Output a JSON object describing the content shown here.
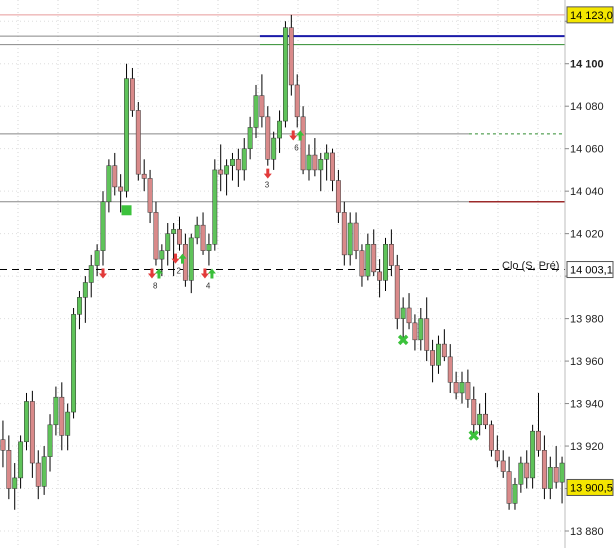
{
  "chart_data": {
    "type": "candlestick",
    "ylim": [
      13872,
      14130
    ],
    "grid": true,
    "colors": {
      "up": "#5fc35a",
      "down": "#d98a8a",
      "wick": "#000000",
      "blue_line": "#1a1aa8",
      "green_line": "#2e8b2e",
      "pink_line": "#e89a9a",
      "red_line": "#9c2a2a",
      "gray_line": "#888888",
      "label_bg": "#f4e600"
    },
    "y_ticks": [
      {
        "value": 13880,
        "label": "13 880",
        "bold": false
      },
      {
        "value": 13900,
        "label": "",
        "bold": false
      },
      {
        "value": 13920,
        "label": "13 920",
        "bold": false
      },
      {
        "value": 13940,
        "label": "13 940",
        "bold": false
      },
      {
        "value": 13960,
        "label": "13 960",
        "bold": false
      },
      {
        "value": 13980,
        "label": "13 980",
        "bold": false
      },
      {
        "value": 14000,
        "label": "",
        "bold": false
      },
      {
        "value": 14020,
        "label": "14 020",
        "bold": false
      },
      {
        "value": 14040,
        "label": "14 040",
        "bold": false
      },
      {
        "value": 14060,
        "label": "14 060",
        "bold": false
      },
      {
        "value": 14080,
        "label": "14 080",
        "bold": false
      },
      {
        "value": 14100,
        "label": "14 100",
        "bold": true
      },
      {
        "value": 14120,
        "label": "",
        "bold": false
      }
    ],
    "price_labels": [
      {
        "value": 14123.0,
        "label": "14 123,0",
        "style": "yellow"
      },
      {
        "value": 14003.1,
        "label": "14 003,1",
        "style": "outlined"
      },
      {
        "value": 13900.5,
        "label": "13 900,5",
        "style": "yellow"
      }
    ],
    "levels": [
      {
        "value": 14123,
        "x0": 0,
        "x1": 1,
        "color": "pink",
        "dash": false
      },
      {
        "value": 14113,
        "x0": 0,
        "x1": 0.46,
        "color": "gray",
        "dash": false
      },
      {
        "value": 14113,
        "x0": 0.46,
        "x1": 1,
        "color": "blue",
        "dash": false
      },
      {
        "value": 14109,
        "x0": 0,
        "x1": 0.46,
        "color": "gray",
        "dash": false
      },
      {
        "value": 14109,
        "x0": 0.46,
        "x1": 1,
        "color": "green",
        "dash": false
      },
      {
        "value": 14067,
        "x0": 0,
        "x1": 0.83,
        "color": "gray",
        "dash": false
      },
      {
        "value": 14067,
        "x0": 0.83,
        "x1": 1,
        "color": "green",
        "dash": true
      },
      {
        "value": 14035,
        "x0": 0,
        "x1": 0.83,
        "color": "gray",
        "dash": false
      },
      {
        "value": 14035,
        "x0": 0.83,
        "x1": 1,
        "color": "red",
        "dash": false
      },
      {
        "value": 14003.1,
        "x0": 0,
        "x1": 1,
        "color": "black",
        "dash": true
      }
    ],
    "annotation": {
      "text": "Clo (S, Pré)",
      "value": 14003.1
    },
    "candles": [
      [
        13923,
        13932,
        13910,
        13918
      ],
      [
        13918,
        13925,
        13895,
        13900
      ],
      [
        13900,
        13912,
        13890,
        13905
      ],
      [
        13905,
        13925,
        13900,
        13922
      ],
      [
        13922,
        13945,
        13918,
        13941
      ],
      [
        13941,
        13946,
        13905,
        13912
      ],
      [
        13912,
        13918,
        13895,
        13901
      ],
      [
        13901,
        13920,
        13897,
        13915
      ],
      [
        13915,
        13935,
        13908,
        13930
      ],
      [
        13930,
        13948,
        13925,
        13943
      ],
      [
        13943,
        13950,
        13918,
        13925
      ],
      [
        13925,
        13940,
        13918,
        13936
      ],
      [
        13936,
        13985,
        13933,
        13982
      ],
      [
        13982,
        13993,
        13975,
        13990
      ],
      [
        13990,
        14000,
        13978,
        13997
      ],
      [
        13997,
        14010,
        13990,
        14005
      ],
      [
        14005,
        14015,
        14000,
        14012
      ],
      [
        14012,
        14040,
        14005,
        14035
      ],
      [
        14035,
        14055,
        14030,
        14052
      ],
      [
        14052,
        14058,
        14038,
        14042
      ],
      [
        14042,
        14048,
        14030,
        14040
      ],
      [
        14040,
        14100,
        14037,
        14093
      ],
      [
        14093,
        14098,
        14075,
        14078
      ],
      [
        14078,
        14082,
        14045,
        14048
      ],
      [
        14048,
        14055,
        14040,
        14046
      ],
      [
        14046,
        14050,
        14025,
        14030
      ],
      [
        14030,
        14035,
        14005,
        14008
      ],
      [
        14008,
        14015,
        14000,
        14012
      ],
      [
        14012,
        14025,
        14005,
        14020
      ],
      [
        14020,
        14025,
        14000,
        14022
      ],
      [
        14022,
        14028,
        14012,
        14015
      ],
      [
        14015,
        14020,
        13995,
        13998
      ],
      [
        13998,
        14020,
        13992,
        14018
      ],
      [
        14018,
        14028,
        14015,
        14024
      ],
      [
        14024,
        14030,
        14010,
        14012
      ],
      [
        14012,
        14020,
        14005,
        14015
      ],
      [
        14015,
        14055,
        14012,
        14050
      ],
      [
        14050,
        14062,
        14040,
        14048
      ],
      [
        14048,
        14055,
        14038,
        14052
      ],
      [
        14052,
        14058,
        14045,
        14055
      ],
      [
        14055,
        14060,
        14042,
        14050
      ],
      [
        14050,
        14065,
        14045,
        14060
      ],
      [
        14060,
        14075,
        14055,
        14070
      ],
      [
        14070,
        14090,
        14065,
        14085
      ],
      [
        14085,
        14095,
        14070,
        14075
      ],
      [
        14075,
        14080,
        14052,
        14055
      ],
      [
        14055,
        14068,
        14050,
        14065
      ],
      [
        14065,
        14078,
        14058,
        14073
      ],
      [
        14073,
        14120,
        14070,
        14117
      ],
      [
        14117,
        14123,
        14085,
        14090
      ],
      [
        14090,
        14095,
        14070,
        14075
      ],
      [
        14075,
        14080,
        14048,
        14050
      ],
      [
        14050,
        14062,
        14045,
        14057
      ],
      [
        14057,
        14065,
        14047,
        14050
      ],
      [
        14050,
        14058,
        14040,
        14055
      ],
      [
        14055,
        14062,
        14045,
        14058
      ],
      [
        14058,
        14060,
        14040,
        14045
      ],
      [
        14045,
        14050,
        14025,
        14030
      ],
      [
        14030,
        14035,
        14005,
        14010
      ],
      [
        14010,
        14030,
        14005,
        14025
      ],
      [
        14025,
        14030,
        14008,
        14012
      ],
      [
        14012,
        14015,
        13995,
        14000
      ],
      [
        14000,
        14020,
        13998,
        14015
      ],
      [
        14015,
        14022,
        14000,
        14002
      ],
      [
        14002,
        14008,
        13990,
        13998
      ],
      [
        13998,
        14018,
        13993,
        14015
      ],
      [
        14015,
        14022,
        14000,
        14005
      ],
      [
        14005,
        14010,
        13975,
        13980
      ],
      [
        13980,
        13990,
        13970,
        13985
      ],
      [
        13985,
        13992,
        13975,
        13978
      ],
      [
        13978,
        13982,
        13965,
        13970
      ],
      [
        13970,
        13985,
        13965,
        13980
      ],
      [
        13980,
        13990,
        13960,
        13965
      ],
      [
        13965,
        13970,
        13950,
        13958
      ],
      [
        13958,
        13972,
        13954,
        13968
      ],
      [
        13968,
        13975,
        13960,
        13962
      ],
      [
        13962,
        13968,
        13945,
        13950
      ],
      [
        13950,
        13955,
        13942,
        13945
      ],
      [
        13945,
        13955,
        13940,
        13950
      ],
      [
        13950,
        13956,
        13938,
        13942
      ],
      [
        13942,
        13948,
        13925,
        13930
      ],
      [
        13930,
        13940,
        13925,
        13935
      ],
      [
        13935,
        13945,
        13928,
        13930
      ],
      [
        13930,
        13932,
        13915,
        13918
      ],
      [
        13918,
        13925,
        13910,
        13913
      ],
      [
        13913,
        13918,
        13905,
        13908
      ],
      [
        13908,
        13915,
        13890,
        13893
      ],
      [
        13893,
        13905,
        13890,
        13902
      ],
      [
        13902,
        13915,
        13898,
        13912
      ],
      [
        13912,
        13918,
        13900,
        13905
      ],
      [
        13905,
        13930,
        13900,
        13927
      ],
      [
        13927,
        13945,
        13915,
        13918
      ],
      [
        13918,
        13925,
        13895,
        13900
      ],
      [
        13900,
        13915,
        13895,
        13910
      ],
      [
        13910,
        13920,
        13900,
        13903
      ],
      [
        13903,
        13915,
        13893,
        13912
      ]
    ],
    "signals": [
      {
        "index": 17,
        "kind": "sell",
        "label": ""
      },
      {
        "index": 26,
        "kind": "buy",
        "label": "8"
      },
      {
        "index": 30,
        "kind": "buy",
        "label": "2"
      },
      {
        "index": 35,
        "kind": "buy",
        "label": "4"
      },
      {
        "index": 45,
        "kind": "sell",
        "label": "3"
      },
      {
        "index": 50,
        "kind": "buy",
        "label": "6"
      }
    ],
    "markers": [
      {
        "index": 21,
        "value": 14031,
        "shape": "square"
      },
      {
        "index": 68,
        "value": 13970,
        "shape": "x"
      },
      {
        "index": 80,
        "value": 13925,
        "shape": "x"
      }
    ]
  }
}
